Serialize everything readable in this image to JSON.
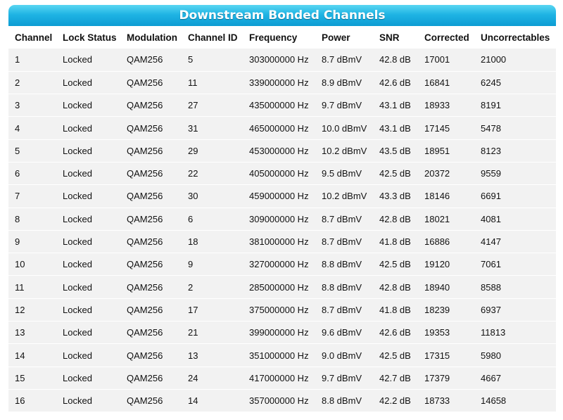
{
  "title": "Downstream Bonded Channels",
  "columns": [
    "Channel",
    "Lock Status",
    "Modulation",
    "Channel ID",
    "Frequency",
    "Power",
    "SNR",
    "Corrected",
    "Uncorrectables"
  ],
  "rows": [
    [
      "1",
      "Locked",
      "QAM256",
      "5",
      "303000000 Hz",
      "8.7 dBmV",
      "42.8 dB",
      "17001",
      "21000"
    ],
    [
      "2",
      "Locked",
      "QAM256",
      "11",
      "339000000 Hz",
      "8.9 dBmV",
      "42.6 dB",
      "16841",
      "6245"
    ],
    [
      "3",
      "Locked",
      "QAM256",
      "27",
      "435000000 Hz",
      "9.7 dBmV",
      "43.1 dB",
      "18933",
      "8191"
    ],
    [
      "4",
      "Locked",
      "QAM256",
      "31",
      "465000000 Hz",
      "10.0 dBmV",
      "43.1 dB",
      "17145",
      "5478"
    ],
    [
      "5",
      "Locked",
      "QAM256",
      "29",
      "453000000 Hz",
      "10.2 dBmV",
      "43.5 dB",
      "18951",
      "8123"
    ],
    [
      "6",
      "Locked",
      "QAM256",
      "22",
      "405000000 Hz",
      "9.5 dBmV",
      "42.5 dB",
      "20372",
      "9559"
    ],
    [
      "7",
      "Locked",
      "QAM256",
      "30",
      "459000000 Hz",
      "10.2 dBmV",
      "43.3 dB",
      "18146",
      "6691"
    ],
    [
      "8",
      "Locked",
      "QAM256",
      "6",
      "309000000 Hz",
      "8.7 dBmV",
      "42.8 dB",
      "18021",
      "4081"
    ],
    [
      "9",
      "Locked",
      "QAM256",
      "18",
      "381000000 Hz",
      "8.7 dBmV",
      "41.8 dB",
      "16886",
      "4147"
    ],
    [
      "10",
      "Locked",
      "QAM256",
      "9",
      "327000000 Hz",
      "8.8 dBmV",
      "42.5 dB",
      "19120",
      "7061"
    ],
    [
      "11",
      "Locked",
      "QAM256",
      "2",
      "285000000 Hz",
      "8.8 dBmV",
      "42.8 dB",
      "18940",
      "8588"
    ],
    [
      "12",
      "Locked",
      "QAM256",
      "17",
      "375000000 Hz",
      "8.7 dBmV",
      "41.8 dB",
      "18239",
      "6937"
    ],
    [
      "13",
      "Locked",
      "QAM256",
      "21",
      "399000000 Hz",
      "9.6 dBmV",
      "42.6 dB",
      "19353",
      "11813"
    ],
    [
      "14",
      "Locked",
      "QAM256",
      "13",
      "351000000 Hz",
      "9.0 dBmV",
      "42.5 dB",
      "17315",
      "5980"
    ],
    [
      "15",
      "Locked",
      "QAM256",
      "24",
      "417000000 Hz",
      "9.7 dBmV",
      "42.7 dB",
      "17379",
      "4667"
    ],
    [
      "16",
      "Locked",
      "QAM256",
      "14",
      "357000000 Hz",
      "8.8 dBmV",
      "42.2 dB",
      "18733",
      "14658"
    ]
  ],
  "colors": {
    "header_gradient_top": "#5ad6f2",
    "header_gradient_bottom": "#0c9cd3",
    "row_background": "#f2f2f2"
  }
}
